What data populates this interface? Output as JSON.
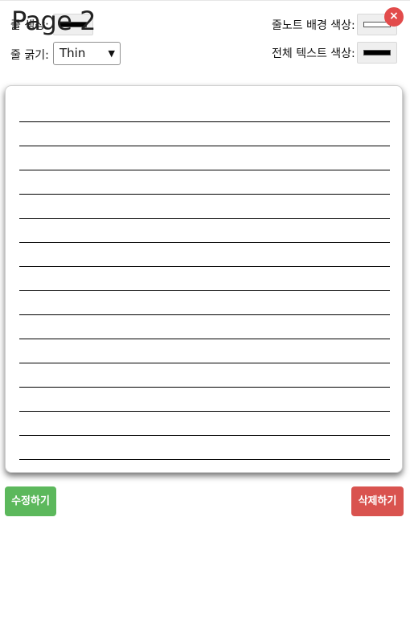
{
  "controls": {
    "line_color_label": "줄 색상:",
    "line_width_label": "줄 굵기:",
    "line_width_value": "Thin",
    "bg_color_label": "줄노트 배경 색상:",
    "text_color_label": "전체 텍스트 색상:",
    "line_color": "#000000",
    "bg_color": "#ffffff",
    "text_color": "#000000"
  },
  "page": {
    "title": "Page 2",
    "close_label": "×"
  },
  "note": {
    "line_count": 15
  },
  "actions": {
    "edit_label": "수정하기",
    "delete_label": "삭제하기",
    "edit_color": "#5cb85c",
    "delete_color": "#d9534f"
  }
}
